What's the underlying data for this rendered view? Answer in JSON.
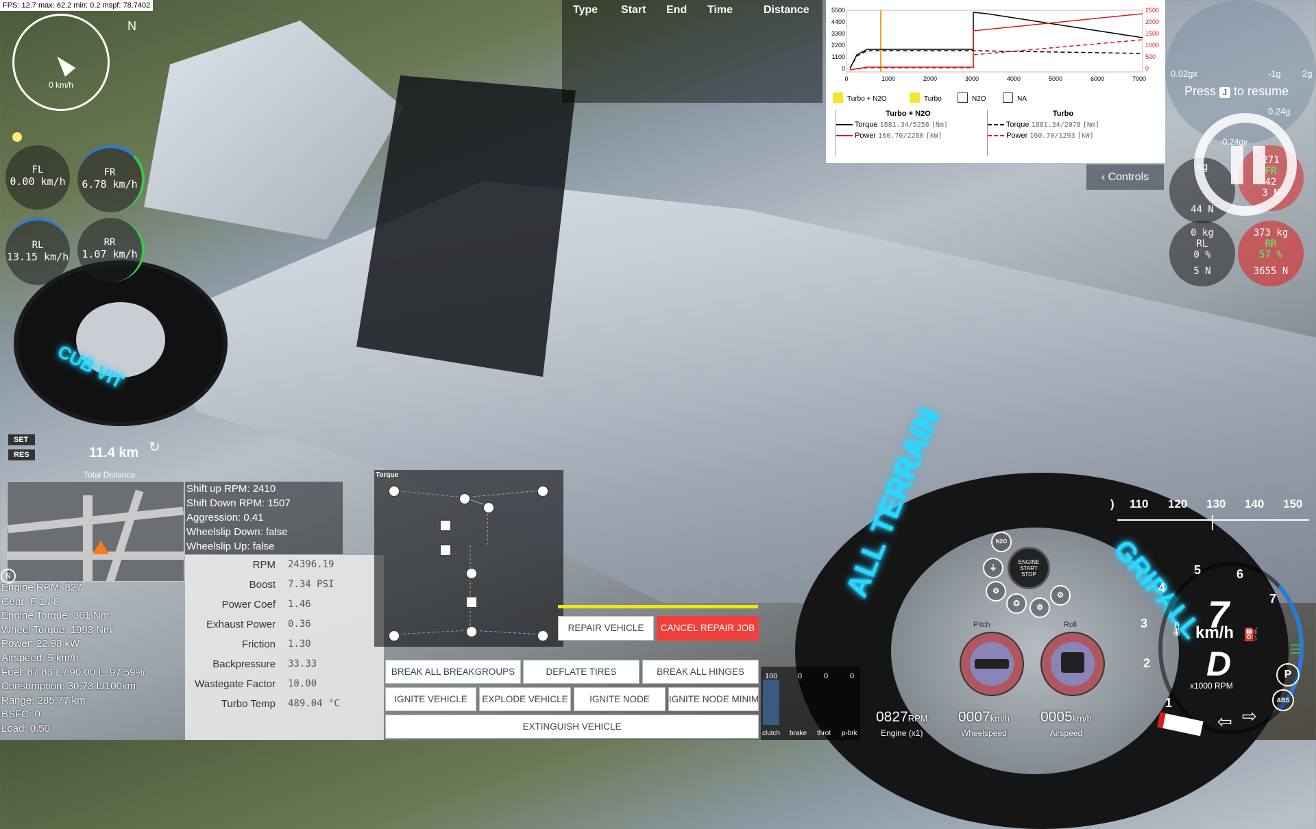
{
  "hud": {
    "fps_text": "FPS: 12.7  max: 62.2  min: 0.2  mspf: 78.7402",
    "compass_speed": "0 km/h",
    "compass_north": "N",
    "wheels": [
      {
        "name": "FL",
        "speed": "0.00 km/h"
      },
      {
        "name": "FR",
        "speed": "6.78 km/h"
      },
      {
        "name": "RL",
        "speed": "13.15 km/h"
      },
      {
        "name": "RR",
        "speed": "1.07 km/h"
      }
    ]
  },
  "timing": {
    "type": "Type",
    "start": "Start",
    "end": "End",
    "time": "Time",
    "distance": "Distance"
  },
  "graph": {
    "y_left_ticks": [
      "5500",
      "4400",
      "3300",
      "2200",
      "1100",
      "0"
    ],
    "y_right_ticks": [
      "2500",
      "2000",
      "1500",
      "1000",
      "500",
      "0"
    ],
    "x_ticks": [
      "0",
      "1000",
      "2000",
      "3000",
      "4000",
      "5000",
      "6000",
      "7000"
    ],
    "checkboxes": [
      {
        "label": "Turbo + N2O",
        "checked": true
      },
      {
        "label": "Turbo",
        "checked": true
      },
      {
        "label": "N2O",
        "checked": false
      },
      {
        "label": "NA",
        "checked": false
      }
    ],
    "groups": [
      {
        "title": "Turbo + N2O",
        "torque_label": "Torque",
        "torque_value": "1881.34/5258",
        "torque_unit": "[Nm]",
        "power_label": "Power",
        "power_value": "160.70/2280",
        "power_unit": "[kW]"
      },
      {
        "title": "Turbo",
        "torque_label": "Torque",
        "torque_value": "1881.34/2078",
        "torque_unit": "[Nm]",
        "power_label": "Power",
        "power_value": "160.70/1293",
        "power_unit": "[kW]"
      }
    ],
    "colors": {
      "torque": "#000000",
      "power": "#e0161b",
      "rpm_marker": "#f2a300"
    }
  },
  "controls_button": "Controls",
  "pause": {
    "press": "Press",
    "key": "J",
    "resume": "to resume"
  },
  "right_gauges": {
    "g_labels": [
      "0.02gx",
      "-1g",
      "2g",
      "0.24g",
      "-0.24gy"
    ],
    "fl": {
      "top": "kg",
      "value": "44",
      "unit": "N"
    },
    "fr": {
      "top": "271",
      "name": "FR",
      "pct": "42",
      "n": "3 N"
    },
    "rl": {
      "kg": "0 kg",
      "name": "RL",
      "pct": "0 %",
      "n": "5 N"
    },
    "rr": {
      "kg": "373 kg",
      "name": "RR",
      "pct": "57 %",
      "n": "3655 N"
    }
  },
  "cruise": {
    "set": "SET",
    "res": "RES"
  },
  "distance": {
    "value": "11.4 km",
    "label": "Total Distance"
  },
  "minimap": {
    "north": "N"
  },
  "stats": [
    "Engine RPM: 827",
    "Gear: F 1 / 8",
    "Engine Torque: 361 Nm",
    "Wheel Torque: 1993 Nm",
    "Power: 22.98 kW",
    "Airspeed: 5 km/h",
    "Fuel: 87.83 L / 90.00 L, 97.59%",
    "Consumption: 30.73 L/100km",
    "Range: 285.77 km",
    "BSFC: 0",
    "Load: 0.50"
  ],
  "shift": [
    "Shift up RPM: 2410",
    "Shift Down RPM: 1507",
    "Aggression: 0.41",
    "Wheelslip Down: false",
    "Wheelslip Up: false"
  ],
  "engine_table": [
    {
      "k": "RPM",
      "v": "24396.19"
    },
    {
      "k": "Boost",
      "v": "7.34 PSI"
    },
    {
      "k": "Power Coef",
      "v": "1.46"
    },
    {
      "k": "Exhaust Power",
      "v": "0.36"
    },
    {
      "k": "Friction",
      "v": "1.30"
    },
    {
      "k": "Backpressure",
      "v": "33.33"
    },
    {
      "k": "Wastegate Factor",
      "v": "10.00"
    },
    {
      "k": "Turbo Temp",
      "v": "489.04 °C"
    }
  ],
  "torque_label": "Torque",
  "buttons": {
    "repair": "REPAIR VEHICLE",
    "cancel_repair": "CANCEL REPAIR JOB",
    "break_groups": "BREAK ALL BREAKGROUPS",
    "deflate": "DEFLATE TIRES",
    "break_hinges": "BREAK ALL HINGES",
    "ignite_vehicle": "IGNITE VEHICLE",
    "explode": "EXPLODE VEHICLE",
    "ignite_node": "IGNITE NODE",
    "ignite_node_min": "IGNITE NODE MINIM",
    "extinguish": "EXTINGUISH VEHICLE"
  },
  "inputs": [
    {
      "label": "clutch",
      "value": "100",
      "level": 1.0
    },
    {
      "label": "brake",
      "value": "0",
      "level": 0
    },
    {
      "label": "throt",
      "value": "0",
      "level": 0
    },
    {
      "label": "p-brk",
      "value": "0",
      "level": 0
    }
  ],
  "readouts": [
    {
      "value": "0827",
      "unit": "RPM",
      "label": "Engine (x1)"
    },
    {
      "value": "0007",
      "unit": "km/h",
      "label": "Wheelspeed"
    },
    {
      "value": "0005",
      "unit": "km/h",
      "label": "Airspeed"
    }
  ],
  "pitch_label": "Pitch",
  "roll_label": "Roll",
  "engine_start": "ENGINE START STOP",
  "n2o_badge": "N2O",
  "speed_tape": [
    ")",
    "110",
    "120",
    "130",
    "140",
    "150"
  ],
  "tacho": {
    "gear_speed": "7",
    "unit": "km/h",
    "mode": "D",
    "rpm_label": "x1000 RPM",
    "ticks": [
      "1",
      "2",
      "3",
      "4",
      "5",
      "6",
      "7"
    ],
    "abs": "ABS",
    "park": "P"
  },
  "tire_text": {
    "left": "CUB VIT",
    "right1": "ALL TERRAIN",
    "right2": "GRIPALL"
  }
}
